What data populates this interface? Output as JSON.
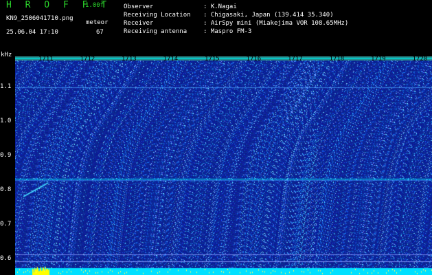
{
  "header": {
    "title": "H R O F F T",
    "version": "1.00f",
    "filename": "KN9_2506041710.png",
    "meteor_label": "meteor",
    "datetime": "25.06.04 17:10",
    "meteor_count": "67",
    "info": [
      {
        "key": "Observer",
        "value": ": K.Nagai"
      },
      {
        "key": "Receiving Location",
        "value": ": Chigasaki, Japan (139.414 35.340)"
      },
      {
        "key": "Receiver",
        "value": ": AirSpy mini (Miakejima VOR 108.65MHz)"
      },
      {
        "key": "Receiving antenna",
        "value": ": Maspro FM-3"
      }
    ]
  },
  "axes": {
    "y_unit": "kHz",
    "y_ticks": [
      "1.1",
      "1.0",
      "0.9",
      "0.8",
      "0.7",
      "0.6"
    ],
    "x_ticks": [
      "1711",
      "1712",
      "1713",
      "1714",
      "1715",
      "1716",
      "1717",
      "1718",
      "1719",
      "1720"
    ]
  },
  "colors": {
    "background": "#000000",
    "spectrogram_base": "#0a1a9a",
    "noise_light": "#3aa0ff",
    "highlight": "#00ffff",
    "bottom_bar": "#ffff00"
  }
}
